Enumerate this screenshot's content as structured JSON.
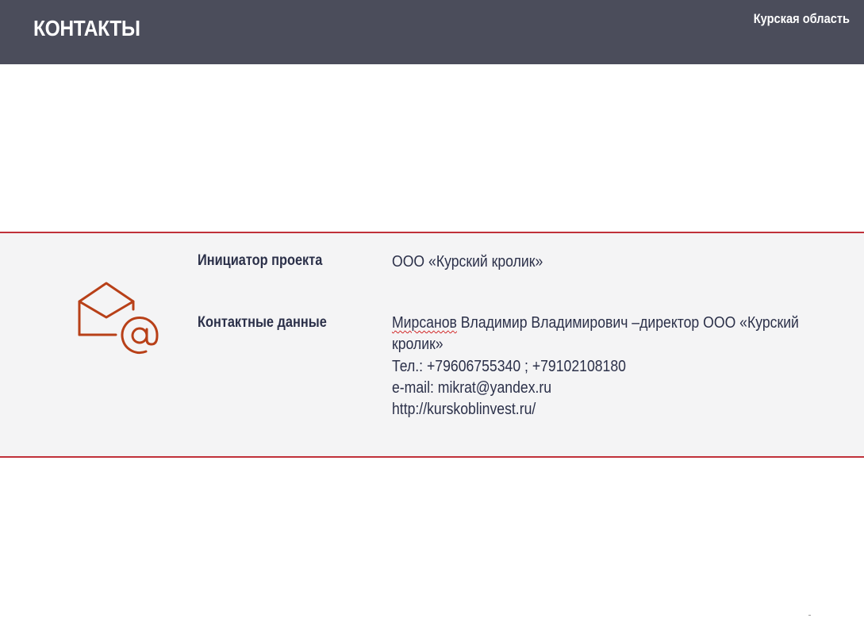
{
  "header": {
    "title": "КОНТАКТЫ",
    "region": "Курская область",
    "background_color": "#4b4d5b"
  },
  "contacts": {
    "icon": "mail-at-icon",
    "accent_color": "#c0313a",
    "icon_color": "#b84018",
    "initiator": {
      "label": "Инициатор проекта",
      "value": "ООО «Курский кролик»"
    },
    "contact_data": {
      "label": "Контактные  данные",
      "surname": "Мирсанов",
      "person_rest": " Владимир Владимирович –директор ООО «Курский",
      "person_cont": "кролик»",
      "phone": "Тел.:  +79606755340 ; +79102108180",
      "email": "e-mail:  mikrat@yandex.ru",
      "website": "http://kurskoblinvest.ru/"
    }
  }
}
